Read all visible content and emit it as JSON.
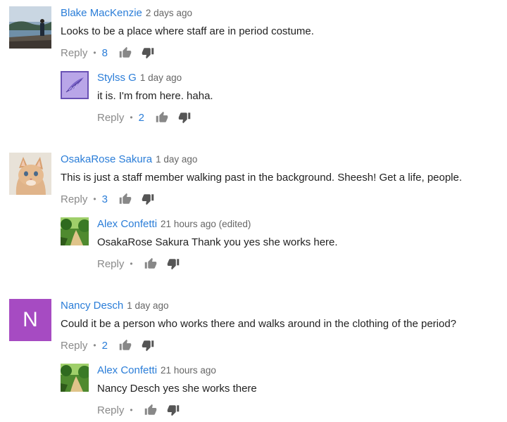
{
  "comments": [
    {
      "author": "Blake MacKenzie",
      "time": "2 days ago",
      "text": "Looks to be a place where staff are in period costume.",
      "reply_label": "Reply",
      "likes": "8",
      "avatar": "landscape-photo-avatar"
    },
    {
      "author": "Stylss G",
      "time": "1 day ago",
      "text": "it is. I'm from here. haha.",
      "reply_label": "Reply",
      "likes": "2",
      "avatar": "purple-feather-avatar"
    },
    {
      "author": "OsakaRose Sakura",
      "time": "1 day ago",
      "text": "This is just a staff member walking past in the background. Sheesh! Get a life, people.",
      "reply_label": "Reply",
      "likes": "3",
      "avatar": "kitten-photo-avatar"
    },
    {
      "author": "Alex Confetti",
      "time": "21 hours ago (edited)",
      "text": "OsakaRose Sakura Thank you yes she works here.",
      "reply_label": "Reply",
      "likes": "",
      "avatar": "forest-path-avatar"
    },
    {
      "author": "Nancy Desch",
      "time": "1 day ago",
      "text": "Could it be a person who works there and walks around in the clothing of the period?",
      "reply_label": "Reply",
      "likes": "2",
      "avatar": "letter-avatar",
      "avatar_letter": "N"
    },
    {
      "author": "Alex Confetti",
      "time": "21 hours ago",
      "text": "Nancy Desch yes she works there",
      "reply_label": "Reply",
      "likes": "",
      "avatar": "forest-path-avatar"
    }
  ],
  "colors": {
    "author_link": "#2a7dd8",
    "like_count": "#2a7dd8",
    "muted": "#8a8a8a",
    "letter_avatar_bg": "#a64bc2"
  }
}
